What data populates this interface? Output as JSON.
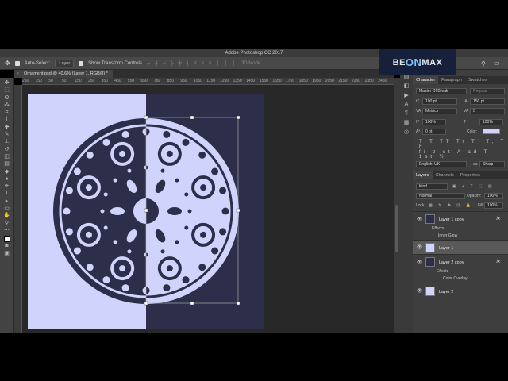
{
  "app": {
    "title": "Adobe Photoshop CC 2017"
  },
  "options_bar": {
    "auto_select_label": "Auto-Select:",
    "auto_select_value": "Layer",
    "show_transform_label": "Show Transform Controls",
    "mode_3d_label": "3D Mode:"
  },
  "document": {
    "tab_label": "Ornament.psd @ 40.6% (Layer 1, RGB/8) *",
    "ruler_ticks": [
      "250",
      "200",
      "150",
      "100",
      "50",
      "0",
      "50",
      "100",
      "150",
      "200",
      "250",
      "300",
      "350",
      "400",
      "450",
      "500",
      "550",
      "600",
      "650",
      "700",
      "750",
      "800",
      "850",
      "900",
      "950",
      "1000",
      "1050",
      "1100",
      "1150",
      "1200",
      "1250",
      "1300",
      "1350",
      "1400",
      "1450",
      "1500",
      "1550",
      "1600",
      "1650",
      "1700",
      "1750",
      "1800",
      "1850",
      "1900",
      "1950",
      "2000",
      "2050",
      "2100",
      "2150",
      "2200",
      "2250",
      "2300",
      "2350",
      "2400",
      "2450",
      "2500"
    ],
    "left_color": "#d0d4fd",
    "right_color": "#2d2f4a"
  },
  "watermark": {
    "part1": "BE",
    "part2": "ON",
    "part3": "MAX"
  },
  "character_panel": {
    "tabs": [
      "Character",
      "Paragraph",
      "Swatches"
    ],
    "font_family": "Master Of Break",
    "font_style": "Regular",
    "font_size": "100 pt",
    "leading": "150 pt",
    "kerning": "Metrics",
    "tracking": "0",
    "vertical_scale": "100%",
    "horizontal_scale": "100%",
    "baseline_shift": "0 pt",
    "color_label": "Color:",
    "type_styles": "T T TT Tr T' T, T F",
    "open_type": "fi σ st A ad T 1st ½",
    "language": "English: UK",
    "anti_alias": "Sharp"
  },
  "layers_panel": {
    "tabs": [
      "Layers",
      "Channels",
      "Properties"
    ],
    "kind_filter": "Kind",
    "blend_mode": "Normal",
    "opacity_label": "Opacity:",
    "opacity_value": "100%",
    "lock_label": "Lock:",
    "fill_label": "Fill:",
    "fill_value": "100%",
    "layers": [
      {
        "name": "Layer 1 copy",
        "fx": "fx",
        "effects_label": "Effects",
        "effect": "Inner Glow"
      },
      {
        "name": "Layer 1"
      },
      {
        "name": "Layer 2 copy",
        "fx": "fx",
        "effects_label": "Effects",
        "effect": "Color Overlay"
      },
      {
        "name": "Layer 2"
      }
    ]
  }
}
